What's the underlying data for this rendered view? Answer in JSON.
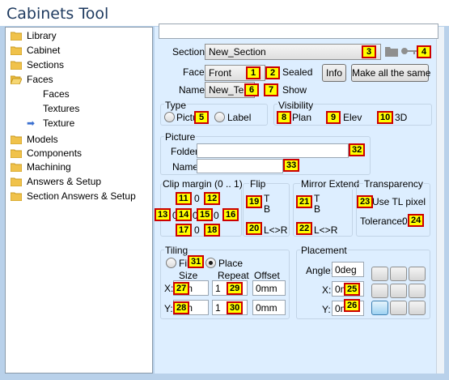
{
  "window": {
    "title": "Cabinets Tool"
  },
  "tree": {
    "items": [
      {
        "label": "Library",
        "icon": "folder-icon",
        "level": 0
      },
      {
        "label": "Cabinet",
        "icon": "folder-icon",
        "level": 0
      },
      {
        "label": "Sections",
        "icon": "folder-icon",
        "level": 0
      },
      {
        "label": "Faces",
        "icon": "open-folder-icon",
        "level": 0
      },
      {
        "label": "Faces",
        "icon": "",
        "level": 1
      },
      {
        "label": "Textures",
        "icon": "",
        "level": 1
      },
      {
        "label": "Texture",
        "icon": "arrow-icon",
        "level": 1,
        "selected": true
      },
      {
        "label": "Models",
        "icon": "folder-icon",
        "level": 0
      },
      {
        "label": "Components",
        "icon": "folder-icon",
        "level": 0
      },
      {
        "label": "Machining",
        "icon": "folder-icon",
        "level": 0
      },
      {
        "label": "Answers & Setup",
        "icon": "folder-icon",
        "level": 0
      },
      {
        "label": "Section Answers & Setup",
        "icon": "folder-icon",
        "level": 0
      }
    ]
  },
  "main": {
    "top_input": "",
    "section": {
      "label": "Section:",
      "value": "New_Section"
    },
    "face": {
      "label": "Face:",
      "value": "Front",
      "sealed_label": "Sealed"
    },
    "name": {
      "label": "Name:",
      "value": "New_Tex",
      "show_label": "Show"
    },
    "info_button": "Info",
    "make_same_button": "Make all the same",
    "type": {
      "title": "Type",
      "picture_label": "Pictu",
      "label_label": "Label"
    },
    "visibility": {
      "title": "Visibility",
      "plan": "Plan",
      "elev": "Elev",
      "three_d": "3D"
    },
    "picture": {
      "title": "Picture",
      "folder_label": "Folder:",
      "folder_value": "",
      "name_label": "Name:",
      "name_value": ""
    },
    "clip": {
      "title": "Clip margin (0 .. 1)",
      "top": "0",
      "left": "0",
      "center": "0",
      "right": "0",
      "bottom": "0"
    },
    "flip": {
      "title": "Flip",
      "t": "T",
      "b": "B",
      "lr": "L<>R"
    },
    "mirror": {
      "title": "Mirror Extend",
      "t": "T",
      "b": "B",
      "lr": "L<>R"
    },
    "transparency": {
      "title": "Transparency",
      "use_tl": "Use TL pixel",
      "tolerance_label": "Tolerance:",
      "tolerance_value": "0"
    },
    "tiling": {
      "title": "Tiling",
      "fill": "Fill",
      "place": "Place",
      "size_h": "Size",
      "repeat_h": "Repeat",
      "offset_h": "Offset",
      "x_label": "X:",
      "y_label": "Y:",
      "x_size": "mm",
      "y_size": "mm",
      "x_repeat": "1",
      "y_repeat": "1",
      "x_offset": "0mm",
      "y_offset": "0mm"
    },
    "placement": {
      "title": "Placement",
      "angle_label": "Angle:",
      "angle_value": "0deg",
      "x_label": "X:",
      "x_value": "0m",
      "y_label": "Y:",
      "y_value": "0m"
    }
  },
  "badges": [
    "1",
    "2",
    "3",
    "4",
    "5",
    "6",
    "7",
    "8",
    "9",
    "10",
    "11",
    "12",
    "13",
    "14",
    "15",
    "16",
    "17",
    "18",
    "19",
    "20",
    "21",
    "22",
    "23",
    "24",
    "25",
    "26",
    "27",
    "28",
    "29",
    "30",
    "31",
    "32",
    "33"
  ],
  "colors": {
    "accent": "#3c7fb1",
    "badge_fill": "#ffff00",
    "badge_border": "#cc0000",
    "panel_bg": "#ddeeff"
  }
}
